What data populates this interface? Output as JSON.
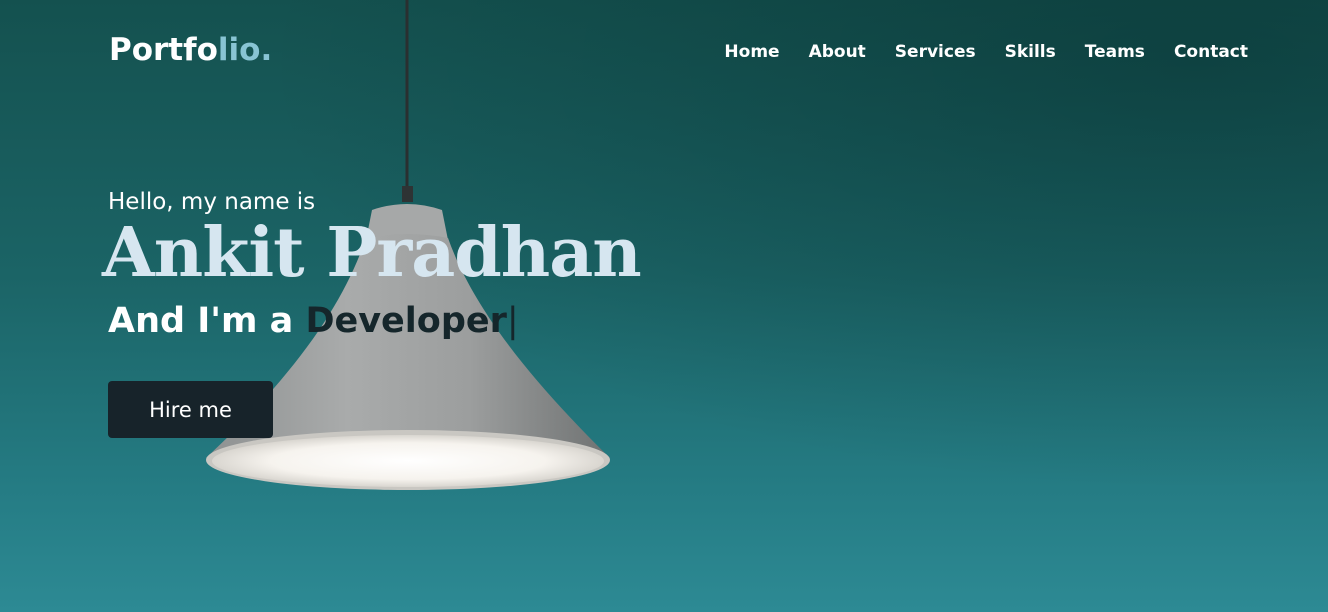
{
  "navbar": {
    "logo_main": "Portfo",
    "logo_accent": "lio.",
    "menu": [
      "Home",
      "About",
      "Services",
      "Skills",
      "Teams",
      "Contact"
    ]
  },
  "hero": {
    "greeting": "Hello, my name is",
    "name": "Ankit Pradhan",
    "role_prefix": "And I'm a ",
    "role_typed": "Developer",
    "cursor": "|",
    "cta_label": "Hire me"
  },
  "colors": {
    "background_top": "#14514f",
    "background_bottom": "#2d8a94",
    "logo_accent": "#88c4d4",
    "name_color": "#d6e6f0",
    "typed_text": "#15262b",
    "button_bg": "#17232a",
    "lamp_shade": "#9a9c9c"
  },
  "icons": {
    "decor": "pendant-lamp-image"
  }
}
